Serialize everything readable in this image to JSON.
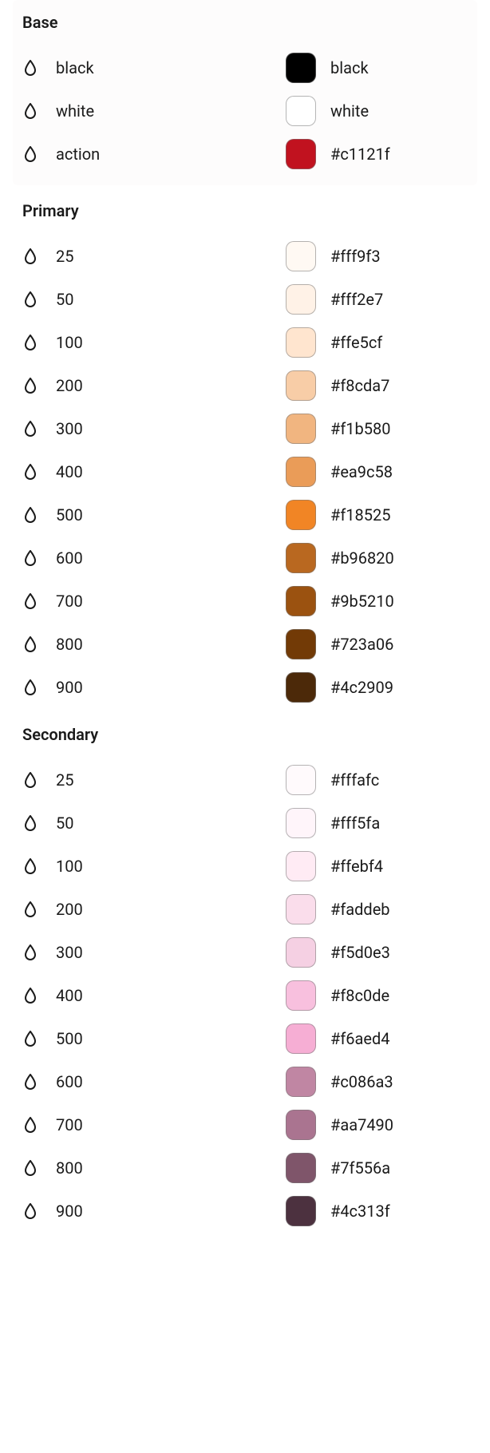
{
  "groups": [
    {
      "title": "Base",
      "key": "base",
      "bg": true,
      "items": [
        {
          "name": "black",
          "swatch": "#000000",
          "swatchLabel": "black"
        },
        {
          "name": "white",
          "swatch": "#ffffff",
          "swatchLabel": "white"
        },
        {
          "name": "action",
          "swatch": "#c1121f",
          "swatchLabel": "#c1121f"
        }
      ]
    },
    {
      "title": "Primary",
      "key": "primary",
      "bg": false,
      "items": [
        {
          "name": "25",
          "swatch": "#fff9f3",
          "swatchLabel": "#fff9f3"
        },
        {
          "name": "50",
          "swatch": "#fff2e7",
          "swatchLabel": "#fff2e7"
        },
        {
          "name": "100",
          "swatch": "#ffe5cf",
          "swatchLabel": "#ffe5cf"
        },
        {
          "name": "200",
          "swatch": "#f8cda7",
          "swatchLabel": "#f8cda7"
        },
        {
          "name": "300",
          "swatch": "#f1b580",
          "swatchLabel": "#f1b580"
        },
        {
          "name": "400",
          "swatch": "#ea9c58",
          "swatchLabel": "#ea9c58"
        },
        {
          "name": "500",
          "swatch": "#f18525",
          "swatchLabel": "#f18525"
        },
        {
          "name": "600",
          "swatch": "#b96820",
          "swatchLabel": "#b96820"
        },
        {
          "name": "700",
          "swatch": "#9b5210",
          "swatchLabel": "#9b5210"
        },
        {
          "name": "800",
          "swatch": "#723a06",
          "swatchLabel": "#723a06"
        },
        {
          "name": "900",
          "swatch": "#4c2909",
          "swatchLabel": "#4c2909"
        }
      ]
    },
    {
      "title": "Secondary",
      "key": "secondary",
      "bg": false,
      "items": [
        {
          "name": "25",
          "swatch": "#fffafc",
          "swatchLabel": "#fffafc"
        },
        {
          "name": "50",
          "swatch": "#fff5fa",
          "swatchLabel": "#fff5fa"
        },
        {
          "name": "100",
          "swatch": "#ffebf4",
          "swatchLabel": "#ffebf4"
        },
        {
          "name": "200",
          "swatch": "#faddeb",
          "swatchLabel": "#faddeb"
        },
        {
          "name": "300",
          "swatch": "#f5d0e3",
          "swatchLabel": "#f5d0e3"
        },
        {
          "name": "400",
          "swatch": "#f8c0de",
          "swatchLabel": "#f8c0de"
        },
        {
          "name": "500",
          "swatch": "#f6aed4",
          "swatchLabel": "#f6aed4"
        },
        {
          "name": "600",
          "swatch": "#c086a3",
          "swatchLabel": "#c086a3"
        },
        {
          "name": "700",
          "swatch": "#aa7490",
          "swatchLabel": "#aa7490"
        },
        {
          "name": "800",
          "swatch": "#7f556a",
          "swatchLabel": "#7f556a"
        },
        {
          "name": "900",
          "swatch": "#4c313f",
          "swatchLabel": "#4c313f"
        }
      ]
    }
  ]
}
